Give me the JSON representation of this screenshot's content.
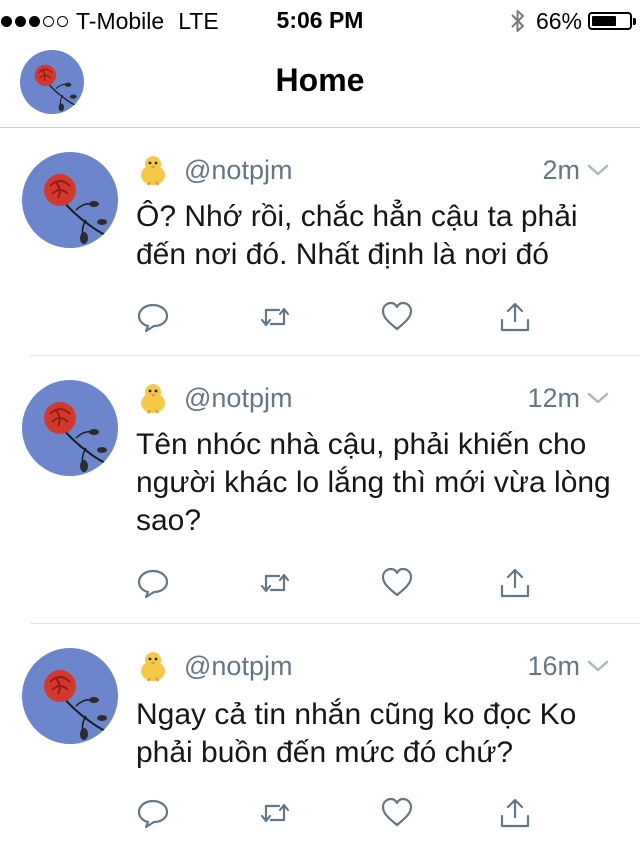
{
  "status_bar": {
    "signal_bars_filled": 3,
    "signal_bars_total": 5,
    "carrier": "T-Mobile",
    "network": "LTE",
    "time": "5:06 PM",
    "battery_percent_label": "66%",
    "battery_level": 0.66,
    "bluetooth_icon": "bluetooth-icon"
  },
  "nav": {
    "title": "Home",
    "avatar_icon": "rose-avatar"
  },
  "tweets": [
    {
      "handle": "@notpjm",
      "time": "2m",
      "emoji": "🐥",
      "text": "Ô? Nhớ rồi, chắc hẳn cậu ta phải đến nơi đó. Nhất định là nơi đó"
    },
    {
      "handle": "@notpjm",
      "time": "12m",
      "emoji": "🐥",
      "text": "Tên nhóc nhà cậu, phải khiến cho người khác lo lắng thì mới vừa lòng sao?"
    },
    {
      "handle": "@notpjm",
      "time": "16m",
      "emoji": "🐥",
      "text": "Ngay cả tin nhắn cũng ko đọc Ko phải buồn đến mức đó chứ?"
    }
  ],
  "colors": {
    "secondary_text": "#657786",
    "primary_text": "#14171a",
    "icon": "#657786",
    "avatar_bg": "#6b86cc",
    "rose": "#d4382c"
  },
  "icons": [
    "reply-icon",
    "retweet-icon",
    "like-icon",
    "share-icon",
    "chevron-down-icon"
  ]
}
